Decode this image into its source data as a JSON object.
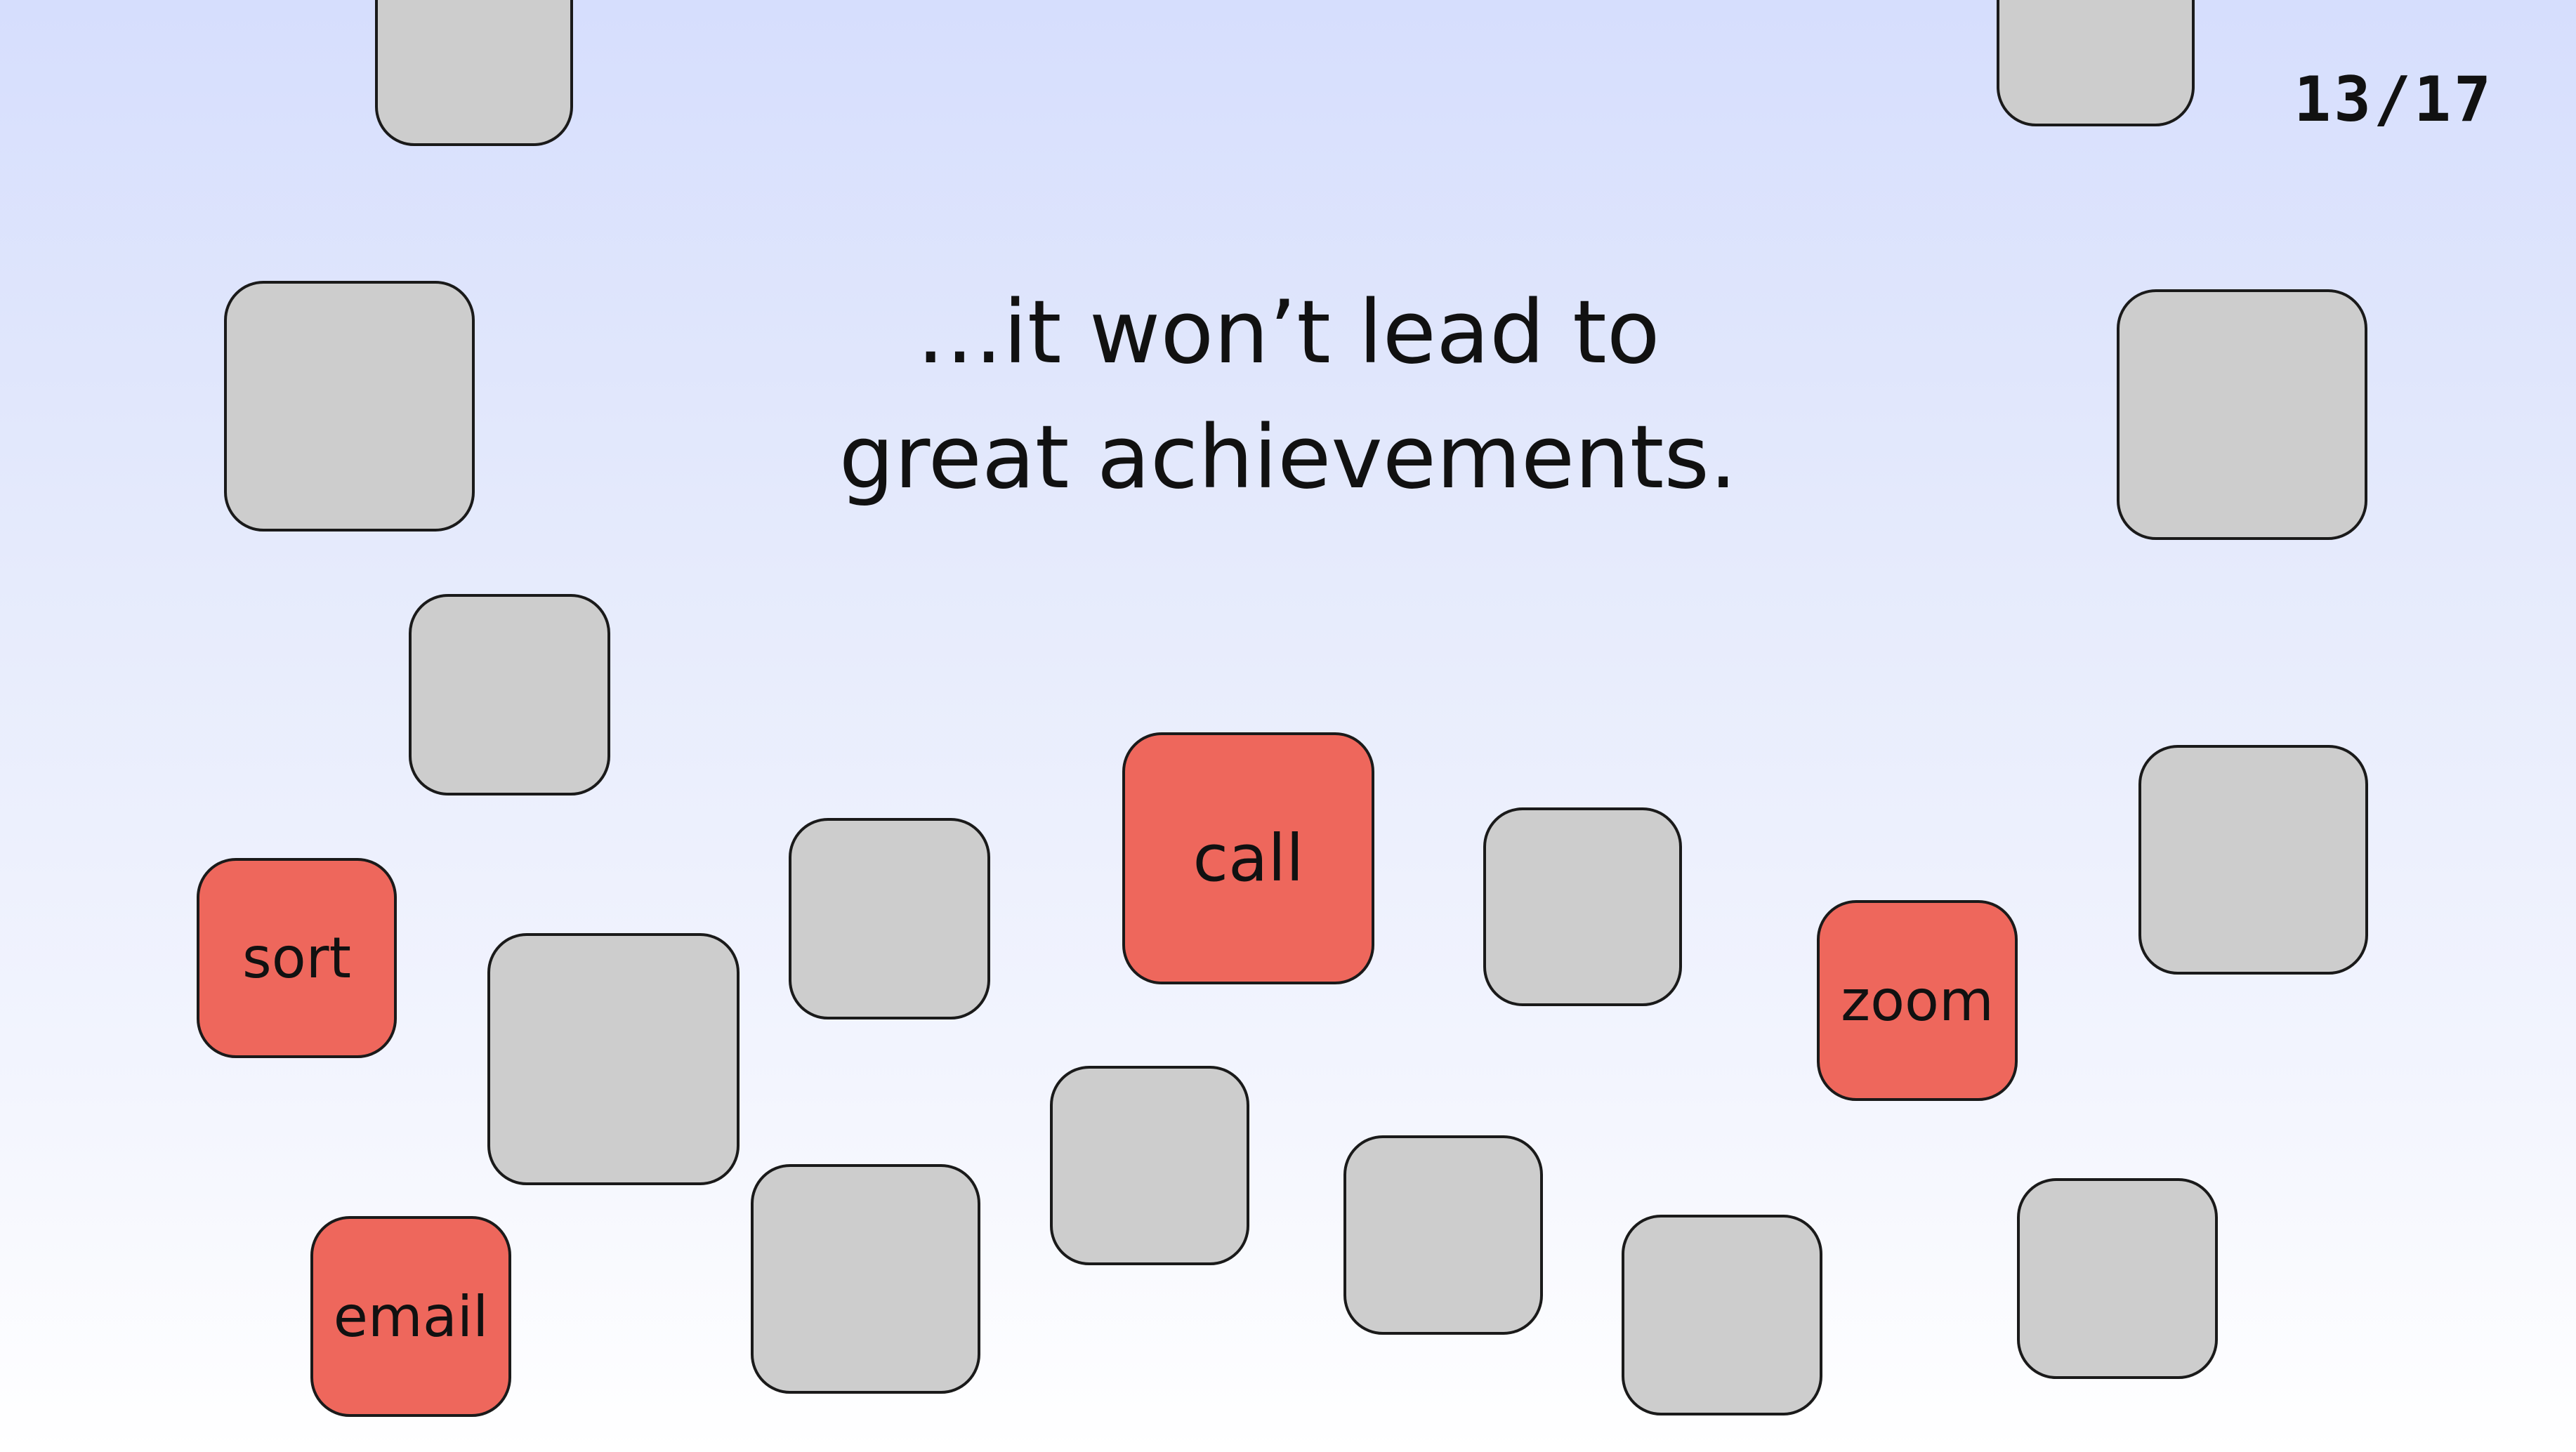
{
  "slide": {
    "counter": "13/17",
    "headline_line1": "…it won’t lead to",
    "headline_line2": "great achievements."
  },
  "tiles": {
    "active_labels": {
      "sort": "sort",
      "email": "email",
      "call": "call",
      "zoom": "zoom"
    }
  },
  "colors": {
    "tile_inactive": "#cdcdcd",
    "tile_active": "#ee675c",
    "tile_border": "#1a1a1a",
    "background_top": "#d6defd",
    "background_bottom": "#ffffff"
  }
}
